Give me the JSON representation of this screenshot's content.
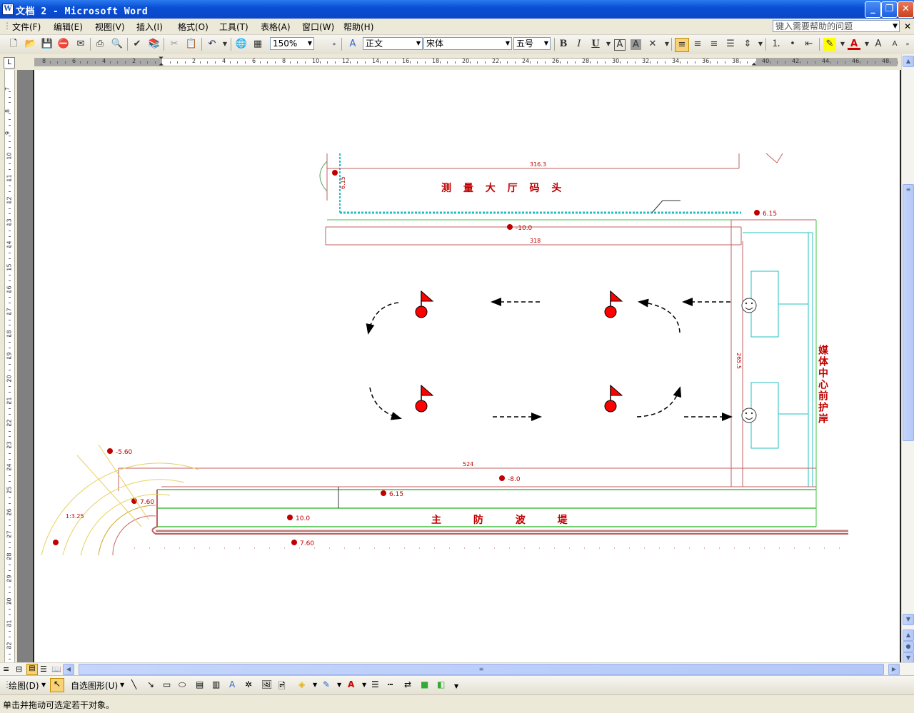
{
  "window": {
    "title": "文档 2 - Microsoft Word",
    "icon": "word-doc-icon"
  },
  "menu": [
    "文件(F)",
    "编辑(E)",
    "视图(V)",
    "插入(I)",
    "格式(O)",
    "工具(T)",
    "表格(A)",
    "窗口(W)",
    "帮助(H)"
  ],
  "help_box": {
    "placeholder": "键入需要帮助的问题"
  },
  "toolbar": {
    "zoom": "150%",
    "style": "正文",
    "font": "宋体",
    "size": "五号",
    "bold": "B",
    "italic": "I",
    "underline": "U",
    "char_border": "A",
    "char_shade": "A"
  },
  "hruler_labels": [
    "8",
    "6",
    "4",
    "2",
    "",
    "2",
    "4",
    "6",
    "8",
    "10",
    "12",
    "14",
    "16",
    "18",
    "20",
    "22",
    "24",
    "26",
    "28",
    "30",
    "32",
    "34",
    "36",
    "38",
    "40",
    "42",
    "44",
    "46",
    "48"
  ],
  "vruler_labels": [
    "7",
    "8",
    "9",
    "10",
    "11",
    "12",
    "13",
    "14",
    "15",
    "16",
    "17",
    "18",
    "19",
    "20",
    "21",
    "22",
    "23",
    "24",
    "25",
    "26",
    "27",
    "28",
    "29",
    "30",
    "31",
    "32"
  ],
  "drawing": {
    "top_label": "测 量 大 厅 码 头",
    "top_dim": "316.3",
    "top_dim2": "318",
    "bottom_dim": "524",
    "right_label": "媒体中心前护岸",
    "bottom_label": "主 防 波 堤",
    "side_dim": "265.5",
    "elevations": [
      "6.15",
      "6.15",
      "-10.0",
      "-8.0",
      "6.15",
      "7.60",
      "10.0",
      "7.60",
      "-5.60"
    ],
    "slope": "1:3.25"
  },
  "draw_toolbar": {
    "draw": "绘图(D)",
    "autoshape": "自选图形(U)"
  },
  "status": {
    "text": "单击并拖动可选定若干对象。"
  },
  "colors": {
    "title": "#0a4fd4",
    "flag": "#ff0000",
    "dim": "#c00000",
    "breakwater": "#00a000",
    "water": "#20c0c0"
  }
}
